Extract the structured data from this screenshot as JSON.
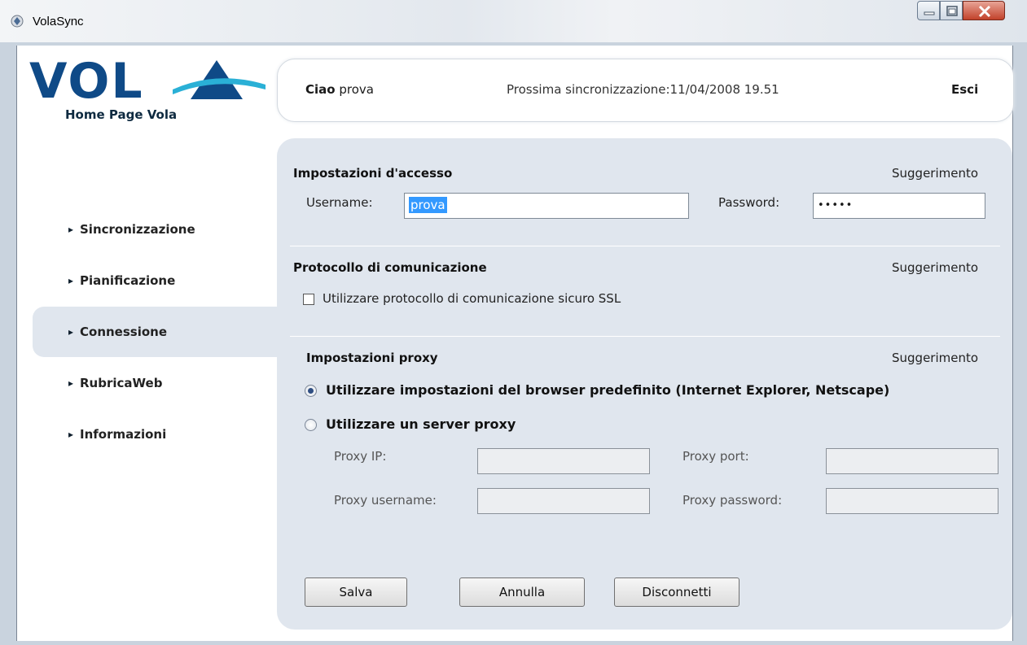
{
  "window": {
    "title": "VolaSync",
    "controls": {
      "minimize_icon": "minimize-icon",
      "maximize_icon": "maximize-icon",
      "close_icon": "close-icon"
    }
  },
  "brand": {
    "logo_text": "VOLA",
    "home_link": "Home Page Vola"
  },
  "header": {
    "greeting": "Ciao",
    "username": "prova",
    "next_sync_label": "Prossima sincronizzazione:11/04/2008 19.51",
    "logout": "Esci"
  },
  "sidebar": {
    "items": [
      {
        "label": "Sincronizzazione",
        "active": false
      },
      {
        "label": "Pianificazione",
        "active": false
      },
      {
        "label": "Connessione",
        "active": true
      },
      {
        "label": "RubricaWeb",
        "active": false
      },
      {
        "label": "Informazioni",
        "active": false
      }
    ]
  },
  "access": {
    "title": "Impostazioni d'accesso",
    "hint": "Suggerimento",
    "username_label": "Username:",
    "username_value": "prova",
    "password_label": "Password:",
    "password_value": "•••••"
  },
  "protocol": {
    "title": "Protocollo di comunicazione",
    "hint": "Suggerimento",
    "ssl_label": "Utilizzare protocollo di comunicazione sicuro SSL",
    "ssl_checked": false
  },
  "proxy": {
    "title": "Impostazioni proxy",
    "hint": "Suggerimento",
    "option_browser": "Utilizzare impostazioni del browser predefinito (Internet Explorer, Netscape)",
    "option_server": "Utilizzare un server proxy",
    "selected": "browser",
    "ip_label": "Proxy IP:",
    "port_label": "Proxy port:",
    "username_label": "Proxy username:",
    "password_label": "Proxy password:",
    "ip_value": "",
    "port_value": "",
    "username_value": "",
    "password_value": ""
  },
  "buttons": {
    "save": "Salva",
    "cancel": "Annulla",
    "disconnect": "Disconnetti"
  },
  "colors": {
    "logo_blue": "#0f4a87",
    "panel_bg": "#e0e6ee",
    "selection": "#3399ff"
  }
}
